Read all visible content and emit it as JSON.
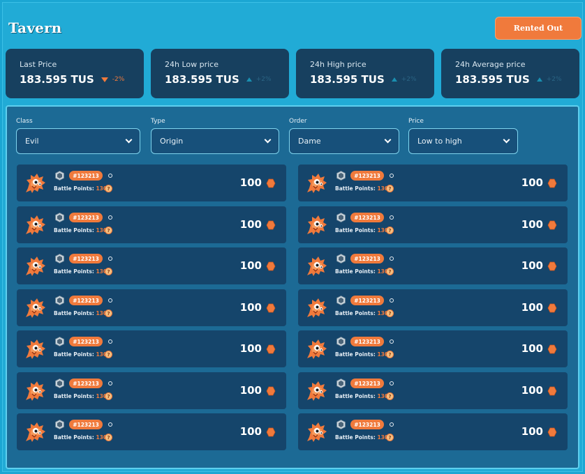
{
  "header": {
    "title": "Tavern",
    "rent_button": "Rented Out"
  },
  "stats": [
    {
      "label": "Last Price",
      "value": "183.595 TUS",
      "delta": "-2%",
      "trend": "down"
    },
    {
      "label": "24h Low price",
      "value": "183.595 TUS",
      "delta": "+2%",
      "trend": "up"
    },
    {
      "label": "24h High price",
      "value": "183.595 TUS",
      "delta": "+2%",
      "trend": "up"
    },
    {
      "label": "24h Average price",
      "value": "183.595 TUS",
      "delta": "+2%",
      "trend": "up"
    }
  ],
  "filters": [
    {
      "label": "Class",
      "value": "Evil"
    },
    {
      "label": "Type",
      "value": "Origin"
    },
    {
      "label": "Order",
      "value": "Dame"
    },
    {
      "label": "Price",
      "value": "Low to high"
    }
  ],
  "listing": {
    "battle_points_label": "Battle Points:",
    "items": [
      {
        "id": "#123213",
        "battle_points": "130",
        "price": "100"
      },
      {
        "id": "#123213",
        "battle_points": "130",
        "price": "100"
      },
      {
        "id": "#123213",
        "battle_points": "130",
        "price": "100"
      },
      {
        "id": "#123213",
        "battle_points": "130",
        "price": "100"
      },
      {
        "id": "#123213",
        "battle_points": "130",
        "price": "100"
      },
      {
        "id": "#123213",
        "battle_points": "130",
        "price": "100"
      },
      {
        "id": "#123213",
        "battle_points": "130",
        "price": "100"
      },
      {
        "id": "#123213",
        "battle_points": "130",
        "price": "100"
      },
      {
        "id": "#123213",
        "battle_points": "130",
        "price": "100"
      },
      {
        "id": "#123213",
        "battle_points": "130",
        "price": "100"
      },
      {
        "id": "#123213",
        "battle_points": "130",
        "price": "100"
      },
      {
        "id": "#123213",
        "battle_points": "130",
        "price": "100"
      },
      {
        "id": "#123213",
        "battle_points": "130",
        "price": "100"
      },
      {
        "id": "#123213",
        "battle_points": "130",
        "price": "100"
      }
    ]
  },
  "icons": {
    "avatar": "orange-creature-icon",
    "class": "class-shield-icon",
    "coin": "orange-hexagon-coin-icon",
    "battle_points": "battle-points-icon"
  },
  "colors": {
    "accent": "#f07a3c",
    "background": "#21abd6",
    "card": "#15456b",
    "stat_card": "#17405f"
  }
}
